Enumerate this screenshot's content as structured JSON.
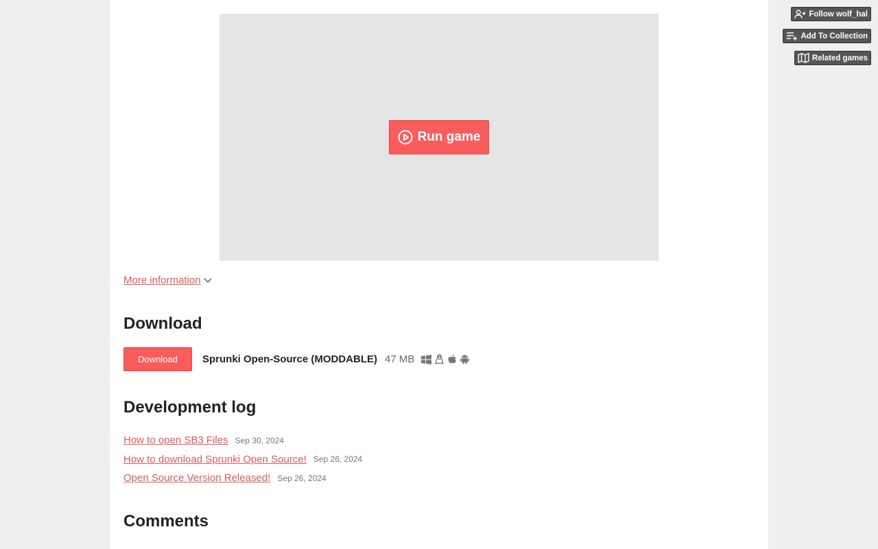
{
  "game": {
    "run_label": "Run game",
    "play_icon": "play-circle-icon"
  },
  "more_info": {
    "label": "More information",
    "icon": "chevron-down-icon"
  },
  "download_section": {
    "heading": "Download",
    "button_label": "Download",
    "file_name": "Sprunki Open-Source (MODDABLE)",
    "file_size": "47 MB",
    "platforms": [
      "windows-icon",
      "linux-icon",
      "apple-icon",
      "android-icon"
    ]
  },
  "devlog": {
    "heading": "Development log",
    "posts": [
      {
        "title": "How to open SB3 Files",
        "date": "Sep 30, 2024"
      },
      {
        "title": "How to download Sprunki Open Source!",
        "date": "Sep 26, 2024"
      },
      {
        "title": "Open Source Version Released!",
        "date": "Sep 26, 2024"
      }
    ]
  },
  "comments": {
    "heading": "Comments"
  },
  "side_actions": {
    "follow": "Follow wolf_hal",
    "collection": "Add To Collection",
    "related": "Related games"
  },
  "colors": {
    "accent": "#fa5c5c",
    "link": "#da5b5b",
    "page_bg": "#efefef",
    "frame_bg": "#e5e5e5",
    "side_button_bg": "#555555"
  }
}
